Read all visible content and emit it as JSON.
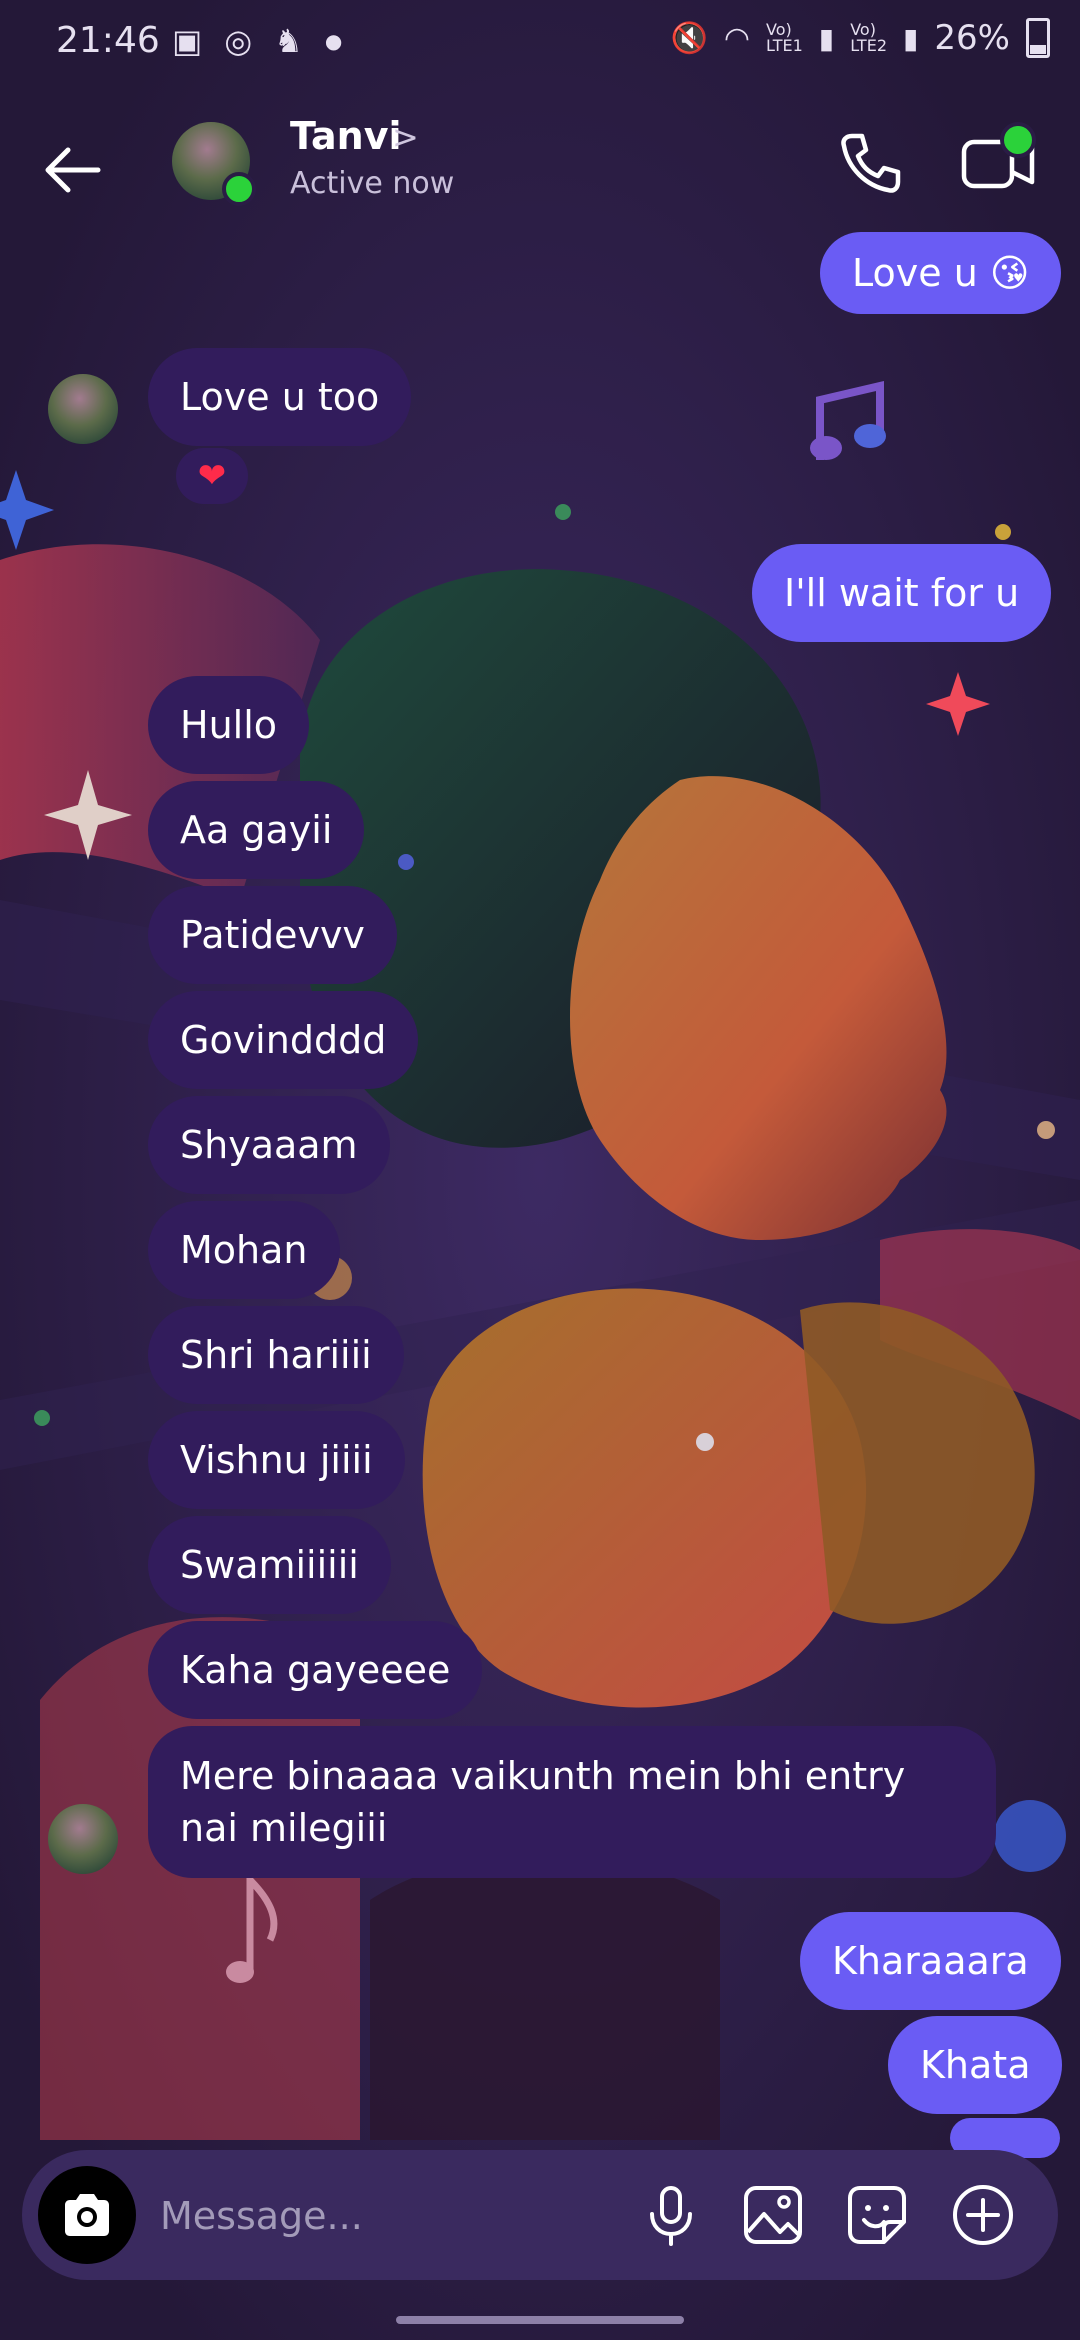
{
  "status_bar": {
    "time": "21:46",
    "battery": "26%",
    "icons": [
      "notification-icon",
      "whatsapp-icon",
      "app-icon",
      "dot-icon",
      "mute-icon",
      "wifi-icon",
      "signal-lte1-icon",
      "signal-lte2-icon",
      "battery-icon"
    ]
  },
  "header": {
    "contact_name": "Tanvi",
    "status": "Active now",
    "chevron": ">"
  },
  "messages": [
    {
      "dir": "out",
      "text": "Love u 😘"
    },
    {
      "dir": "in",
      "text": "Love u too",
      "reaction": "❤"
    },
    {
      "dir": "out",
      "text": "I'll wait for u"
    },
    {
      "dir": "in",
      "text": "Hullo"
    },
    {
      "dir": "in",
      "text": "Aa gayii"
    },
    {
      "dir": "in",
      "text": "Patidevvv"
    },
    {
      "dir": "in",
      "text": "Govindddd"
    },
    {
      "dir": "in",
      "text": "Shyaaam"
    },
    {
      "dir": "in",
      "text": "Mohan"
    },
    {
      "dir": "in",
      "text": "Shri hariiii"
    },
    {
      "dir": "in",
      "text": "Vishnu jiiii"
    },
    {
      "dir": "in",
      "text": "Swamiiiiii"
    },
    {
      "dir": "in",
      "text": "Kaha gayeeee"
    },
    {
      "dir": "in",
      "text": "Mere binaaaa vaikunth mein bhi entry nai milegiii"
    },
    {
      "dir": "out",
      "text": "Kharaaara"
    },
    {
      "dir": "out",
      "text": "Khata"
    }
  ],
  "composer": {
    "placeholder": "Message..."
  },
  "colors": {
    "background": "#2b1d45",
    "outgoing_bubble": "#6a5cf4",
    "incoming_bubble": "#321c5c",
    "online": "#2bd23a"
  }
}
